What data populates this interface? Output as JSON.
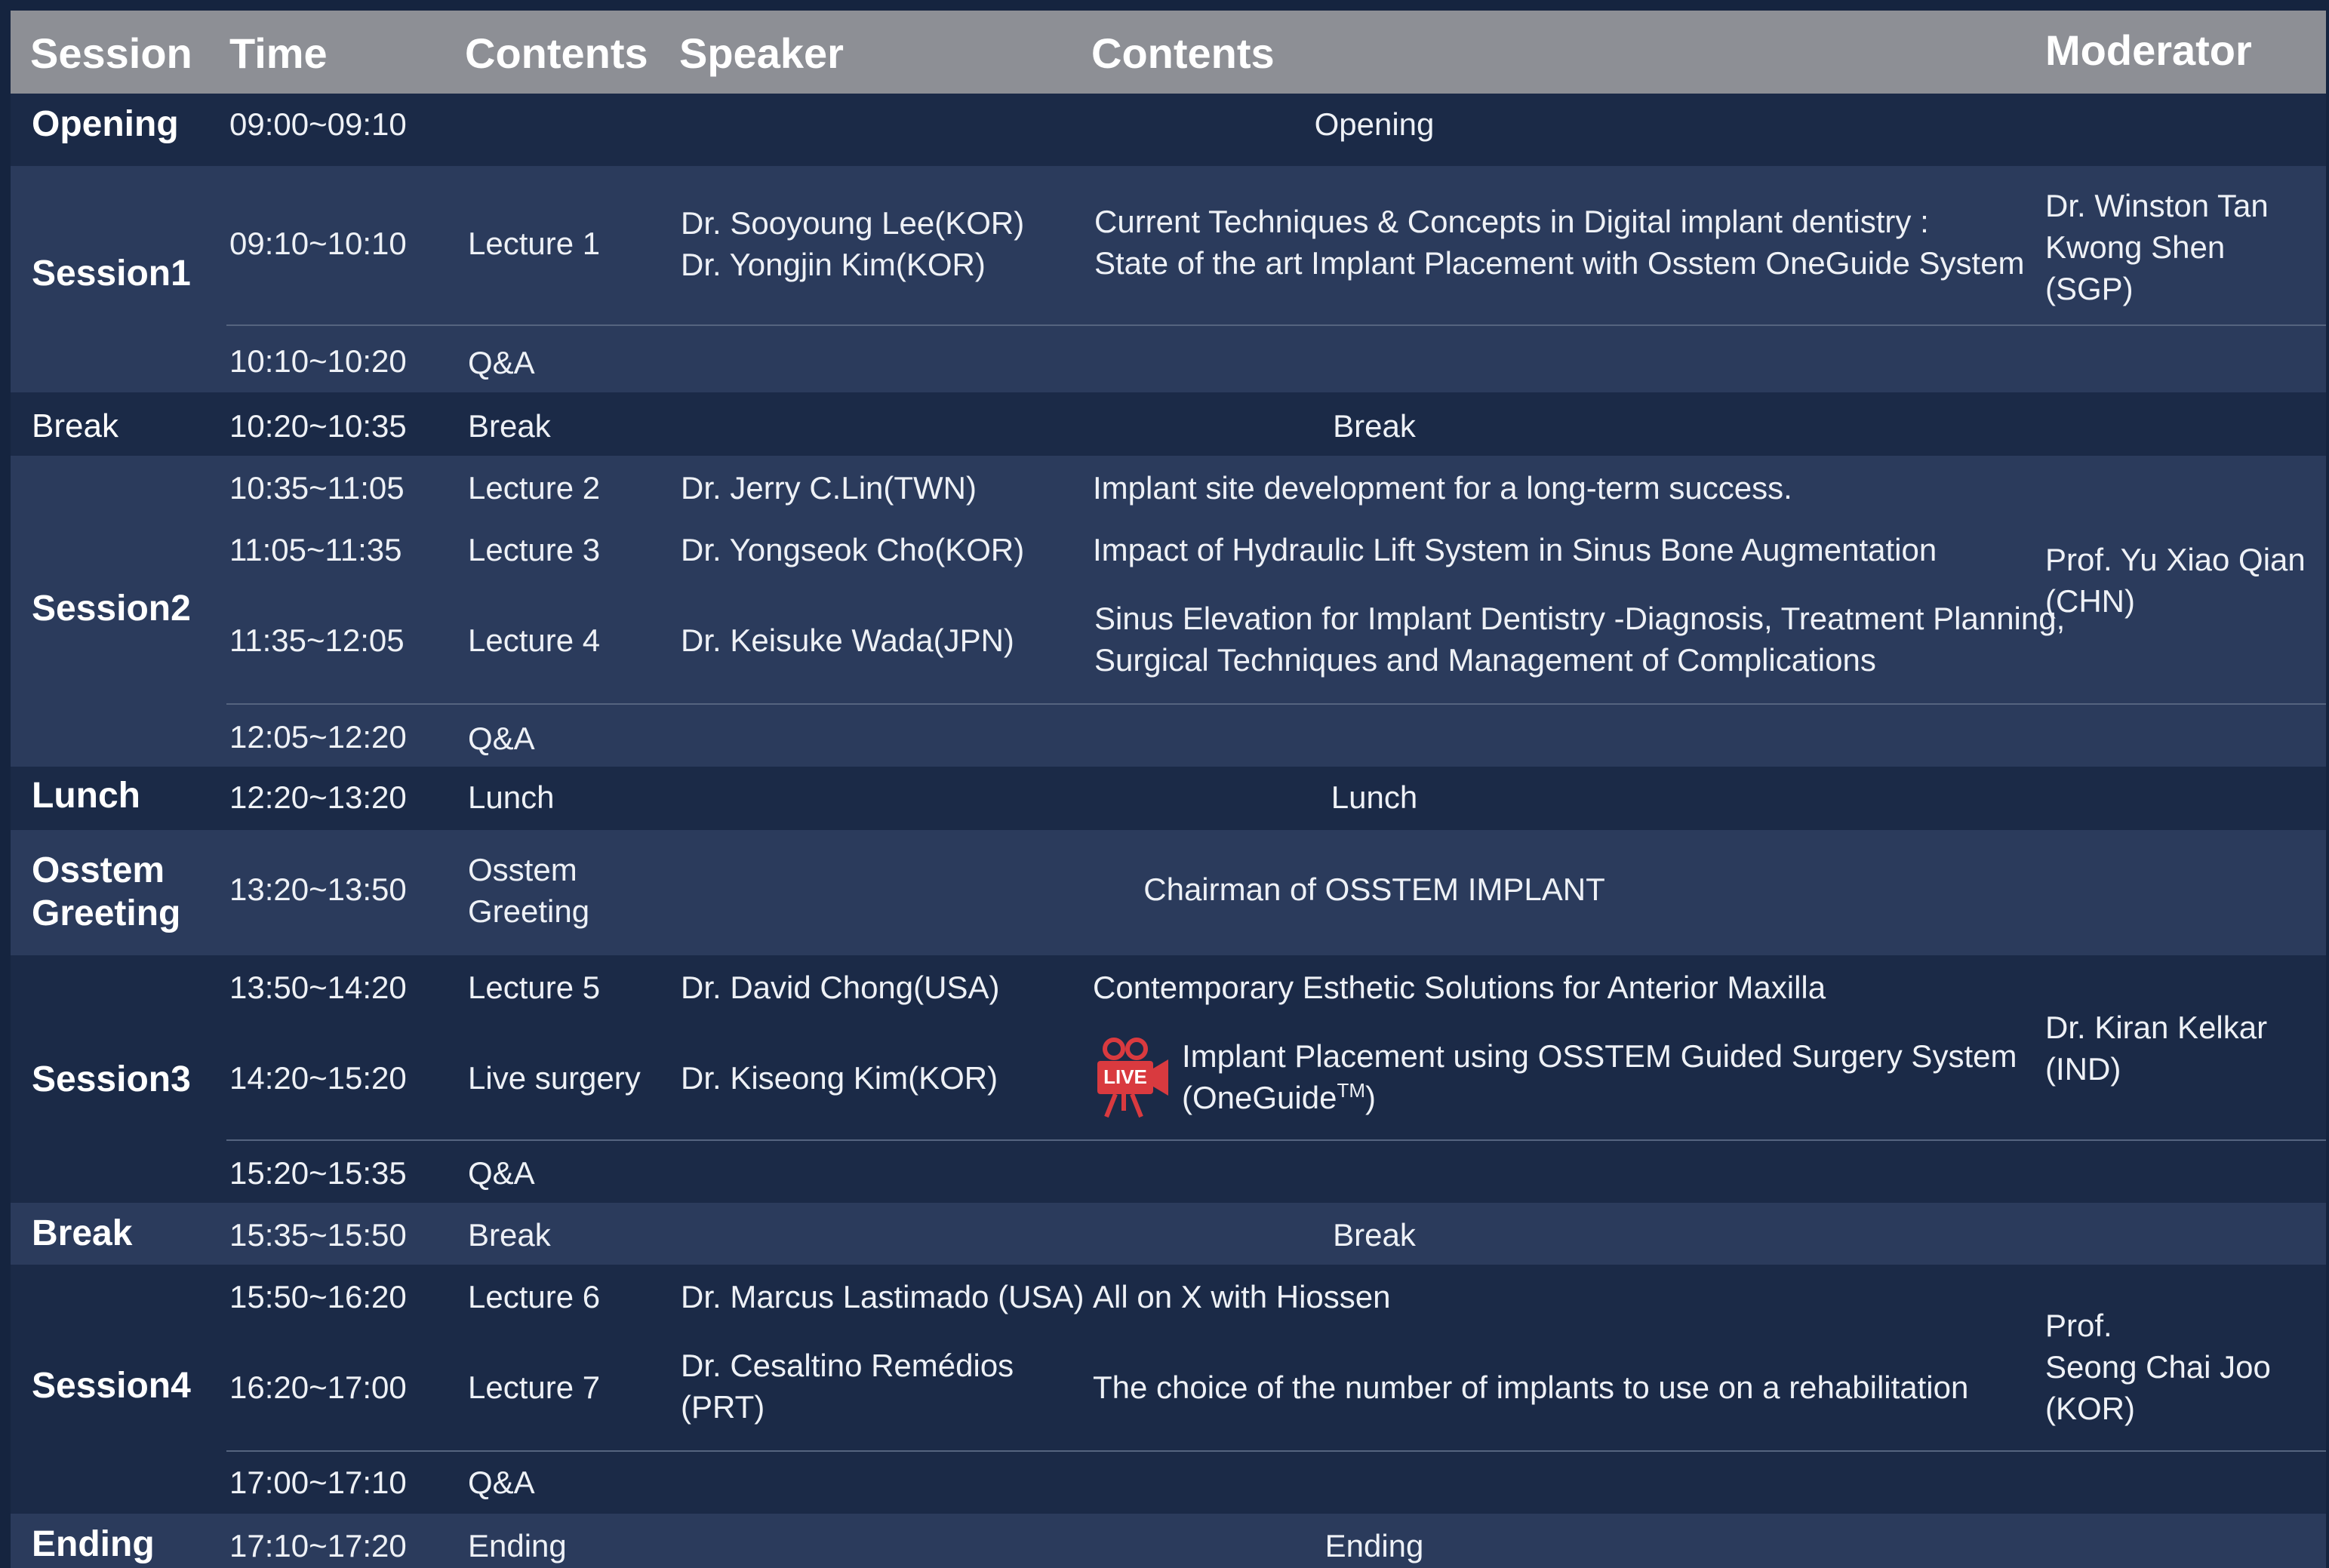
{
  "headers": {
    "session": "Session",
    "time": "Time",
    "contents_type": "Contents",
    "speaker": "Speaker",
    "contents": "Contents",
    "moderator": "Moderator"
  },
  "opening": {
    "session": "Opening",
    "time": "09:00~09:10",
    "contents": "Opening"
  },
  "session1": {
    "label": "Session1",
    "lecture1": {
      "time": "09:10~10:10",
      "type": "Lecture 1",
      "speaker_line1": "Dr. Sooyoung Lee(KOR)",
      "speaker_line2": "Dr. Yongjin Kim(KOR)",
      "title_line1": "Current Techniques & Concepts in Digital implant dentistry :",
      "title_line2": "State of the art Implant Placement with Osstem OneGuide System"
    },
    "qa": {
      "time": "10:10~10:20",
      "type": "Q&A"
    },
    "moderator_line1": "Dr. Winston Tan",
    "moderator_line2": "Kwong Shen",
    "moderator_line3": "(SGP)"
  },
  "break1": {
    "session": "Break",
    "time": "10:20~10:35",
    "type": "Break",
    "contents": "Break"
  },
  "session2": {
    "label": "Session2",
    "lecture2": {
      "time": "10:35~11:05",
      "type": "Lecture 2",
      "speaker": "Dr. Jerry C.Lin(TWN)",
      "title": "Implant site development for a long-term success."
    },
    "lecture3": {
      "time": "11:05~11:35",
      "type": "Lecture 3",
      "speaker": "Dr. Yongseok Cho(KOR)",
      "title": "Impact of Hydraulic Lift System in Sinus Bone Augmentation"
    },
    "lecture4": {
      "time": "11:35~12:05",
      "type": "Lecture 4",
      "speaker": "Dr. Keisuke Wada(JPN)",
      "title_line1": "Sinus Elevation for Implant Dentistry -Diagnosis, Treatment Planning,",
      "title_line2": "Surgical Techniques and Management of Complications"
    },
    "qa": {
      "time": "12:05~12:20",
      "type": "Q&A"
    },
    "moderator_line1": "Prof. Yu Xiao Qian",
    "moderator_line2": "(CHN)"
  },
  "lunch": {
    "session": "Lunch",
    "time": "12:20~13:20",
    "type": "Lunch",
    "contents": "Lunch"
  },
  "greeting": {
    "session_line1": "Osstem",
    "session_line2": "Greeting",
    "time": "13:20~13:50",
    "type_line1": "Osstem",
    "type_line2": "Greeting",
    "contents": "Chairman of OSSTEM IMPLANT"
  },
  "session3": {
    "label": "Session3",
    "lecture5": {
      "time": "13:50~14:20",
      "type": "Lecture 5",
      "speaker": "Dr. David Chong(USA)",
      "title": "Contemporary Esthetic Solutions for Anterior Maxilla"
    },
    "live": {
      "time": "14:20~15:20",
      "type": "Live surgery",
      "speaker": "Dr. Kiseong Kim(KOR)",
      "badge": "LIVE",
      "title_line1": "Implant Placement using OSSTEM Guided Surgery System",
      "title_line2": "(OneGuide",
      "title_tm": "TM",
      "title_close": ")"
    },
    "qa": {
      "time": "15:20~15:35",
      "type": "Q&A"
    },
    "moderator_line1": "Dr. Kiran Kelkar",
    "moderator_line2": "(IND)"
  },
  "break2": {
    "session": "Break",
    "time": "15:35~15:50",
    "type": "Break",
    "contents": "Break"
  },
  "session4": {
    "label": "Session4",
    "lecture6": {
      "time": "15:50~16:20",
      "type": "Lecture 6",
      "speaker": "Dr. Marcus Lastimado (USA)",
      "title": "All on X with Hiossen"
    },
    "lecture7": {
      "time": "16:20~17:00",
      "type": "Lecture 7",
      "speaker_line1": "Dr. Cesaltino Remédios",
      "speaker_line2": "(PRT)",
      "title": "The choice of the number of implants to use on a rehabilitation"
    },
    "qa": {
      "time": "17:00~17:10",
      "type": "Q&A"
    },
    "moderator_line1": "Prof.",
    "moderator_line2": "Seong Chai Joo",
    "moderator_line3": "(KOR)"
  },
  "ending": {
    "session": "Ending",
    "time": "17:10~17:20",
    "type": "Ending",
    "contents": "Ending"
  },
  "colors": {
    "header": "#8d8f95",
    "band_light": "#2b3b5c",
    "band_dark": "#1b2a47",
    "live_red": "#d93a3f"
  }
}
